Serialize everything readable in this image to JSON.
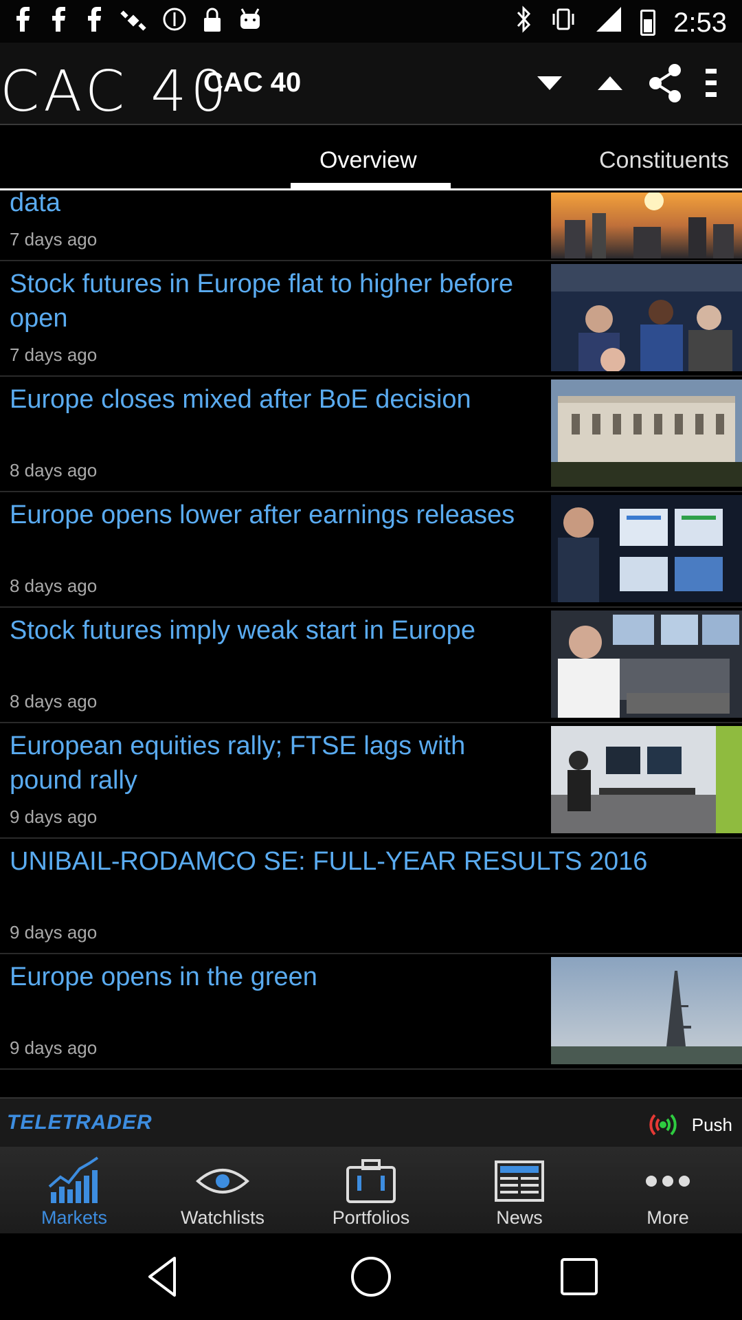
{
  "status_bar": {
    "time": "2:53"
  },
  "app_bar": {
    "logo_text": "CAC 40",
    "title": "CAC 40"
  },
  "tabs": [
    {
      "label": "Overview",
      "active": true
    },
    {
      "label": "Constituents",
      "active": false
    }
  ],
  "news": [
    {
      "title": "European markets open higher ahead of data",
      "time": "7 days ago",
      "has_thumb": true
    },
    {
      "title": "Stock futures in Europe flat to higher before open",
      "time": "7 days ago",
      "has_thumb": true
    },
    {
      "title": "Europe closes mixed after BoE decision",
      "time": "8 days ago",
      "has_thumb": true
    },
    {
      "title": "Europe opens lower after earnings releases",
      "time": "8 days ago",
      "has_thumb": true
    },
    {
      "title": "Stock futures imply weak start in Europe",
      "time": "8 days ago",
      "has_thumb": true
    },
    {
      "title": "European equities rally; FTSE lags with pound rally",
      "time": "9 days ago",
      "has_thumb": true
    },
    {
      "title": "UNIBAIL-RODAMCO SE: FULL-YEAR RESULTS 2016",
      "time": "9 days ago",
      "has_thumb": false
    },
    {
      "title": "Europe opens in the green",
      "time": "9 days ago",
      "has_thumb": true
    }
  ],
  "footer": {
    "brand": "TELETRADER",
    "push_label": "Push"
  },
  "bottom_nav": [
    {
      "label": "Markets",
      "icon": "chart-icon",
      "active": true
    },
    {
      "label": "Watchlists",
      "icon": "eye-icon",
      "active": false
    },
    {
      "label": "Portfolios",
      "icon": "briefcase-icon",
      "active": false
    },
    {
      "label": "News",
      "icon": "newspaper-icon",
      "active": false
    },
    {
      "label": "More",
      "icon": "more-dots-icon",
      "active": false
    }
  ],
  "colors": {
    "accent": "#3d8de0",
    "headline": "#5aabf0",
    "push_green": "#2ecc40",
    "push_red": "#e53935"
  }
}
